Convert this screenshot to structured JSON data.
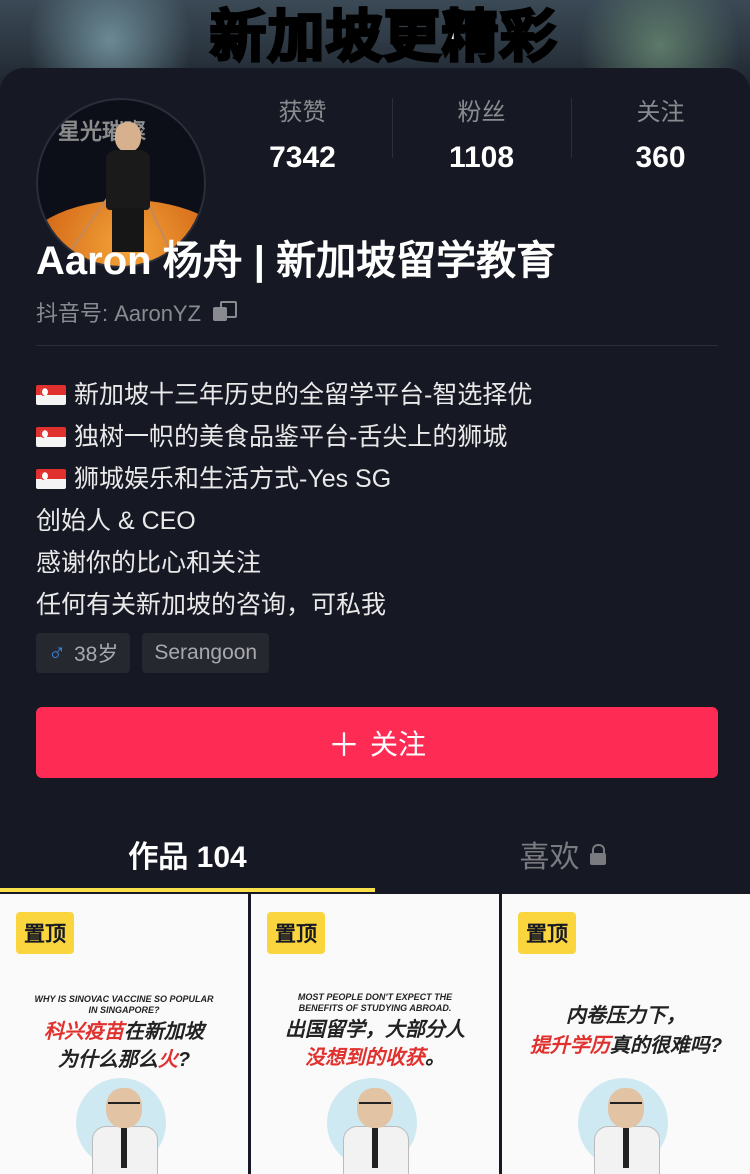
{
  "cover": {
    "text": "新加坡更精彩"
  },
  "profile": {
    "avatar_text": "星光璀璨",
    "stats": [
      {
        "label": "获赞",
        "value": "7342"
      },
      {
        "label": "粉丝",
        "value": "1108"
      },
      {
        "label": "关注",
        "value": "360"
      }
    ],
    "name": "Aaron 杨舟 | 新加坡留学教育",
    "handle": "抖音号: AaronYZ",
    "bio_lines": [
      "新加坡十三年历史的全留学平台-智选择优",
      "独树一帜的美食品鉴平台-舌尖上的狮城",
      "狮城娱乐和生活方式-Yes SG",
      "创始人 & CEO",
      "感谢你的比心和关注",
      "任何有关新加坡的咨询，可私我"
    ],
    "tags": {
      "age": "38岁",
      "location": "Serangoon"
    },
    "follow_label": "关注"
  },
  "tabs": [
    {
      "label": "作品 104"
    },
    {
      "label": "喜欢"
    }
  ],
  "videos": [
    {
      "pin": "置顶",
      "en": "WHY IS SINOVAC VACCINE SO POPULAR IN SINGAPORE?",
      "cn1_red": "科兴疫苗",
      "cn1_rest": "在新加坡",
      "cn2_a": "为什么那么",
      "cn2_red": "火",
      "cn2_b": "?"
    },
    {
      "pin": "置顶",
      "en": "MOST PEOPLE DON'T EXPECT THE BENEFITS OF STUDYING ABROAD.",
      "cn1": "出国留学，大部分人",
      "cn2_red": "没想到的收获",
      "cn2_b": "。"
    },
    {
      "pin": "置顶",
      "cn1": "内卷压力下，",
      "cn2_red": "提升学历",
      "cn2_b": "真的很难吗?"
    }
  ],
  "colors": {
    "accent": "#fe2c55",
    "tab_indicator": "#fae04b",
    "pin_badge": "#fad53d",
    "background": "#161823"
  }
}
